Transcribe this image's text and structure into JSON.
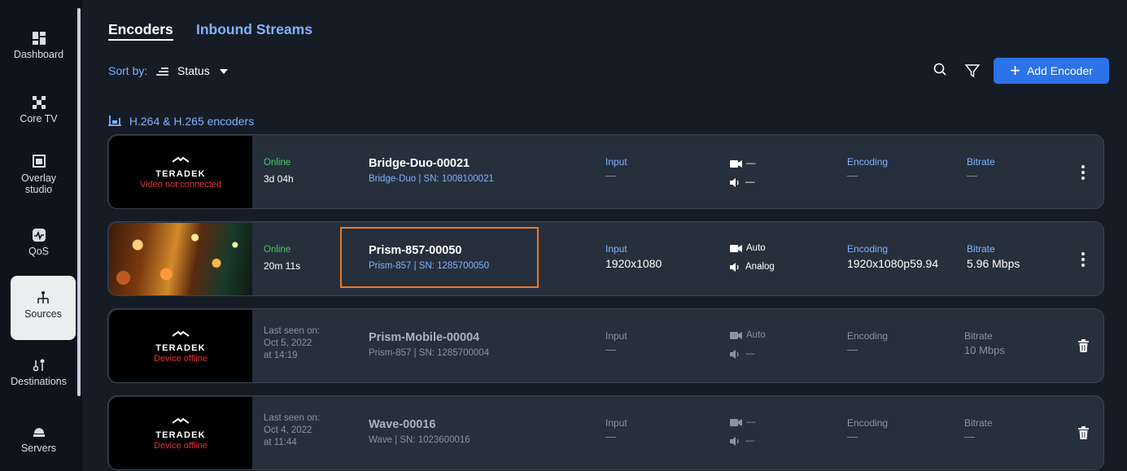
{
  "sidebar": {
    "items": [
      {
        "label": "Dashboard",
        "icon": "dashboard-icon"
      },
      {
        "label": "Core TV",
        "icon": "core-tv-icon"
      },
      {
        "label": "Overlay studio",
        "icon": "overlay-studio-icon"
      },
      {
        "label": "QoS",
        "icon": "qos-icon"
      },
      {
        "label": "Sources",
        "icon": "sources-icon",
        "active": true
      },
      {
        "label": "Destinations",
        "icon": "destinations-icon"
      },
      {
        "label": "Servers",
        "icon": "servers-icon"
      }
    ]
  },
  "tabs": {
    "encoders": "Encoders",
    "inbound": "Inbound Streams"
  },
  "sort": {
    "label": "Sort by:",
    "value": "Status"
  },
  "add_button": "Add Encoder",
  "group_label": "H.264 & H.265 encoders",
  "colors": {
    "accent": "#2c72e8",
    "link": "#7fb3ff",
    "online": "#3fcf63",
    "error": "#e0323a",
    "highlight": "#f07a22",
    "card": "#262f3c",
    "background": "#161c26"
  },
  "encoders": [
    {
      "thumb_logo": "TERADEK",
      "thumb_message": "Video not connected",
      "status_line1": "Online",
      "status_line2": "3d 04h",
      "name": "Bridge-Duo-00021",
      "subtitle": "Bridge-Duo | SN: 1008100021",
      "input_label": "Input",
      "input_value": "—",
      "video": "—",
      "audio": "—",
      "encoding_label": "Encoding",
      "encoding_value": "—",
      "bitrate_label": "Bitrate",
      "bitrate_value": "—"
    },
    {
      "status_line1": "Online",
      "status_line2": "20m 11s",
      "name": "Prism-857-00050",
      "subtitle": "Prism-857 | SN: 1285700050",
      "input_label": "Input",
      "input_value": "1920x1080",
      "video": "Auto",
      "audio": "Analog",
      "encoding_label": "Encoding",
      "encoding_value": "1920x1080p59.94",
      "bitrate_label": "Bitrate",
      "bitrate_value": "5.96 Mbps"
    },
    {
      "thumb_logo": "TERADEK",
      "thumb_message": "Device offline",
      "status_line1": "Last seen on:",
      "status_line2": "Oct 5, 2022",
      "status_line3": "at 14:19",
      "name": "Prism-Mobile-00004",
      "subtitle": "Prism-857 | SN: 1285700004",
      "input_label": "Input",
      "input_value": "—",
      "video": "Auto",
      "audio": "—",
      "encoding_label": "Encoding",
      "encoding_value": "—",
      "bitrate_label": "Bitrate",
      "bitrate_value": "10 Mbps"
    },
    {
      "thumb_logo": "TERADEK",
      "thumb_message": "Device offline",
      "status_line1": "Last seen on:",
      "status_line2": "Oct 4, 2022",
      "status_line3": "at 11:44",
      "name": "Wave-00016",
      "subtitle": "Wave | SN: 1023600016",
      "input_label": "Input",
      "input_value": "—",
      "video": "—",
      "audio": "—",
      "encoding_label": "Encoding",
      "encoding_value": "—",
      "bitrate_label": "Bitrate",
      "bitrate_value": "—"
    }
  ]
}
